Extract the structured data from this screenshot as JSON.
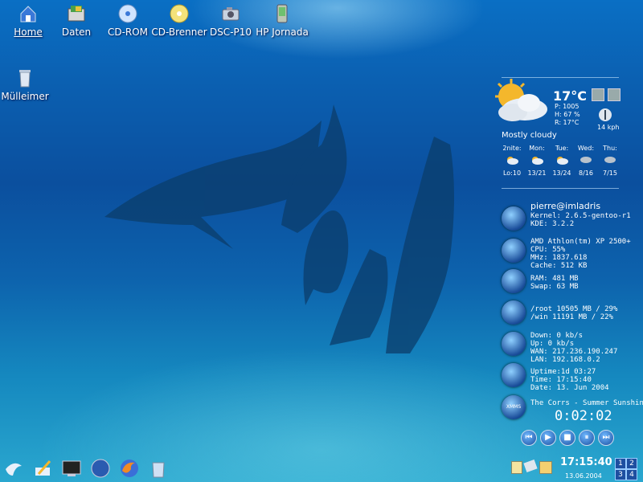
{
  "desktop_icons": [
    {
      "label": "Home",
      "icon": "home-icon"
    },
    {
      "label": "Daten",
      "icon": "folder-data-icon"
    },
    {
      "label": "CD-ROM",
      "icon": "cdrom-icon"
    },
    {
      "label": "CD-Brenner",
      "icon": "cd-burner-icon"
    },
    {
      "label": "DSC-P10",
      "icon": "camera-icon"
    },
    {
      "label": "HP Jornada",
      "icon": "pda-icon"
    },
    {
      "label": "Mülleimer",
      "icon": "trash-icon"
    }
  ],
  "weather": {
    "temp": "17°C",
    "pressure": "P: 1005",
    "humidity": "H: 67 %",
    "realfeel": "R: 17°C",
    "wind": "14 kph",
    "condition": "Mostly cloudy",
    "forecast": [
      {
        "day": "2nite:",
        "temps": "Lo:10"
      },
      {
        "day": "Mon:",
        "temps": "13/21"
      },
      {
        "day": "Tue:",
        "temps": "13/24"
      },
      {
        "day": "Wed:",
        "temps": "8/16"
      },
      {
        "day": "Thu:",
        "temps": "7/15"
      }
    ]
  },
  "sysinfo": {
    "user": "pierre@imladris",
    "kernel_line": "Kernel: 2.6.5-gentoo-r1",
    "kde_line": "KDE:    3.2.2",
    "cpu_name": "AMD Athlon(tm) XP 2500+",
    "cpu_line": "CPU:    55%",
    "mhz_line": "MHz:    1837.618",
    "cache_line": "Cache: 512 KB",
    "ram_line": "RAM:    481 MB",
    "swap_line": "Swap:   63 MB",
    "root_line": "/root     10505 MB / 29%",
    "win_line": "/win      11191 MB / 22%",
    "down_line": "Down:  0 kb/s",
    "up_line": "Up:    0 kb/s",
    "wan_line": "WAN:   217.236.190.247",
    "lan_line": "LAN:   192.168.0.2",
    "uptime_line": "Uptime:1d 03:27",
    "time_line": "Time:   17:15:40",
    "date_line": "Date:   13. Jun 2004"
  },
  "player": {
    "track": "The Corrs - Summer Sunshine",
    "elapsed": "0:02:02",
    "icon_text": "XMMS",
    "controls": [
      "⏮",
      "▶",
      "■",
      "⏸",
      "⏭"
    ]
  },
  "taskbar": {
    "clock_time": "17:15:40",
    "clock_date": "13.06.2004",
    "desktops": [
      "1",
      "2",
      "3",
      "4"
    ],
    "launchers": [
      "kde-menu-icon",
      "editor-icon",
      "terminal-icon",
      "xmms-icon",
      "firefox-icon",
      "trash-launcher-icon"
    ]
  }
}
